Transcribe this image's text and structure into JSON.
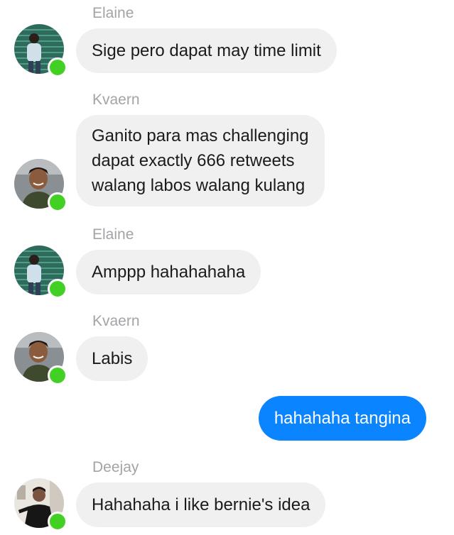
{
  "colors": {
    "incoming_bubble": "#f1f0f0",
    "outgoing_bubble": "#0a84ff",
    "presence": "#42d025",
    "sender_name": "#a3a3a8"
  },
  "messages": [
    {
      "sender": "Elaine",
      "avatar_icon": "elaine-avatar",
      "lines": [
        "Sige pero dapat may time limit"
      ]
    },
    {
      "sender": "Kvaern",
      "avatar_icon": "kvaern-avatar",
      "lines": [
        "Ganito para mas challenging",
        "dapat exactly 666 retweets",
        "walang labos walang kulang"
      ]
    },
    {
      "sender": "Elaine",
      "avatar_icon": "elaine-avatar",
      "lines": [
        "Amppp hahahahaha"
      ]
    },
    {
      "sender": "Kvaern",
      "avatar_icon": "kvaern-avatar",
      "lines": [
        "Labis"
      ]
    },
    {
      "sender": "",
      "outgoing": true,
      "lines": [
        "hahahaha tangina"
      ]
    },
    {
      "sender": "Deejay",
      "avatar_icon": "deejay-avatar",
      "lines": [
        "Hahahaha i like bernie's idea"
      ]
    }
  ]
}
